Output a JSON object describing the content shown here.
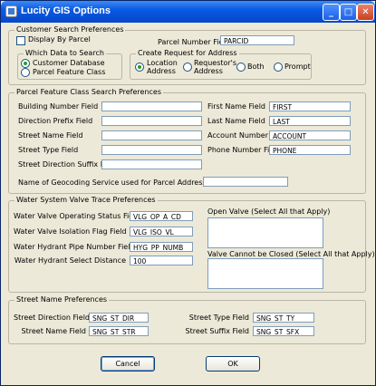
{
  "window": {
    "title": "Lucity GIS Options"
  },
  "customer_search": {
    "legend": "Customer Search Preferences",
    "display_by_parcel": "Display By Parcel",
    "parcel_number_field_label": "Parcel Number Field",
    "parcel_number_field_value": "PARCID",
    "which_data": {
      "legend": "Which Data to Search",
      "options": [
        "Customer Database",
        "Parcel Feature Class"
      ],
      "selected": "Customer Database"
    },
    "create_request": {
      "legend": "Create Request for Address",
      "options": [
        "Location Address",
        "Requestor's Address",
        "Both",
        "Prompt"
      ],
      "option_lines": [
        [
          "Location",
          "Address"
        ],
        [
          "Requestor's",
          "Address"
        ]
      ],
      "selected": "Location Address"
    }
  },
  "parcel_feature": {
    "legend": "Parcel Feature Class Search Preferences",
    "left_fields": [
      {
        "label": "Building Number Field",
        "value": ""
      },
      {
        "label": "Direction Prefix Field",
        "value": ""
      },
      {
        "label": "Street Name Field",
        "value": ""
      },
      {
        "label": "Street Type Field",
        "value": ""
      },
      {
        "label": "Street Direction Suffix Field",
        "value": ""
      }
    ],
    "right_fields": [
      {
        "label": "First Name Field",
        "value": "FIRST"
      },
      {
        "label": "Last Name Field",
        "value": "LAST"
      },
      {
        "label": "Account Number",
        "value": "ACCOUNT"
      },
      {
        "label": "Phone Number Field",
        "value": "PHONE"
      }
    ],
    "geocoding_label": "Name of Geocoding Service used for Parcel Address Searches",
    "geocoding_value": ""
  },
  "water_valve": {
    "legend": "Water System Valve Trace Preferences",
    "fields": [
      {
        "label": "Water Valve Operating Status Field",
        "value": "VLG_OP_A_CD"
      },
      {
        "label": "Water Valve Isolation Flag Field",
        "value": "VLG_ISO_VL"
      },
      {
        "label": "Water Hydrant Pipe Number Field",
        "value": "HYG_PP_NUMB"
      },
      {
        "label": "Water Hydrant Select Distance",
        "value": "100"
      }
    ],
    "open_valve_label": "Open Valve (Select All that Apply)",
    "cannot_close_label": "Valve Cannot be Closed (Select All that Apply)"
  },
  "street_name": {
    "legend": "Street Name Preferences",
    "fields": [
      {
        "label": "Street Direction Field",
        "value": "SNG_ST_DIR"
      },
      {
        "label": "Street Name Field",
        "value": "SNG_ST_STR"
      },
      {
        "label": "Street Type Field",
        "value": "SNG_ST_TY"
      },
      {
        "label": "Street Suffix Field",
        "value": "SNG_ST_SFX"
      }
    ]
  },
  "buttons": {
    "cancel": "Cancel",
    "ok": "OK"
  },
  "colors": {
    "titlebar": "#0a5ae3",
    "dialog_bg": "#ece9d8",
    "field_border": "#7f9db9"
  }
}
